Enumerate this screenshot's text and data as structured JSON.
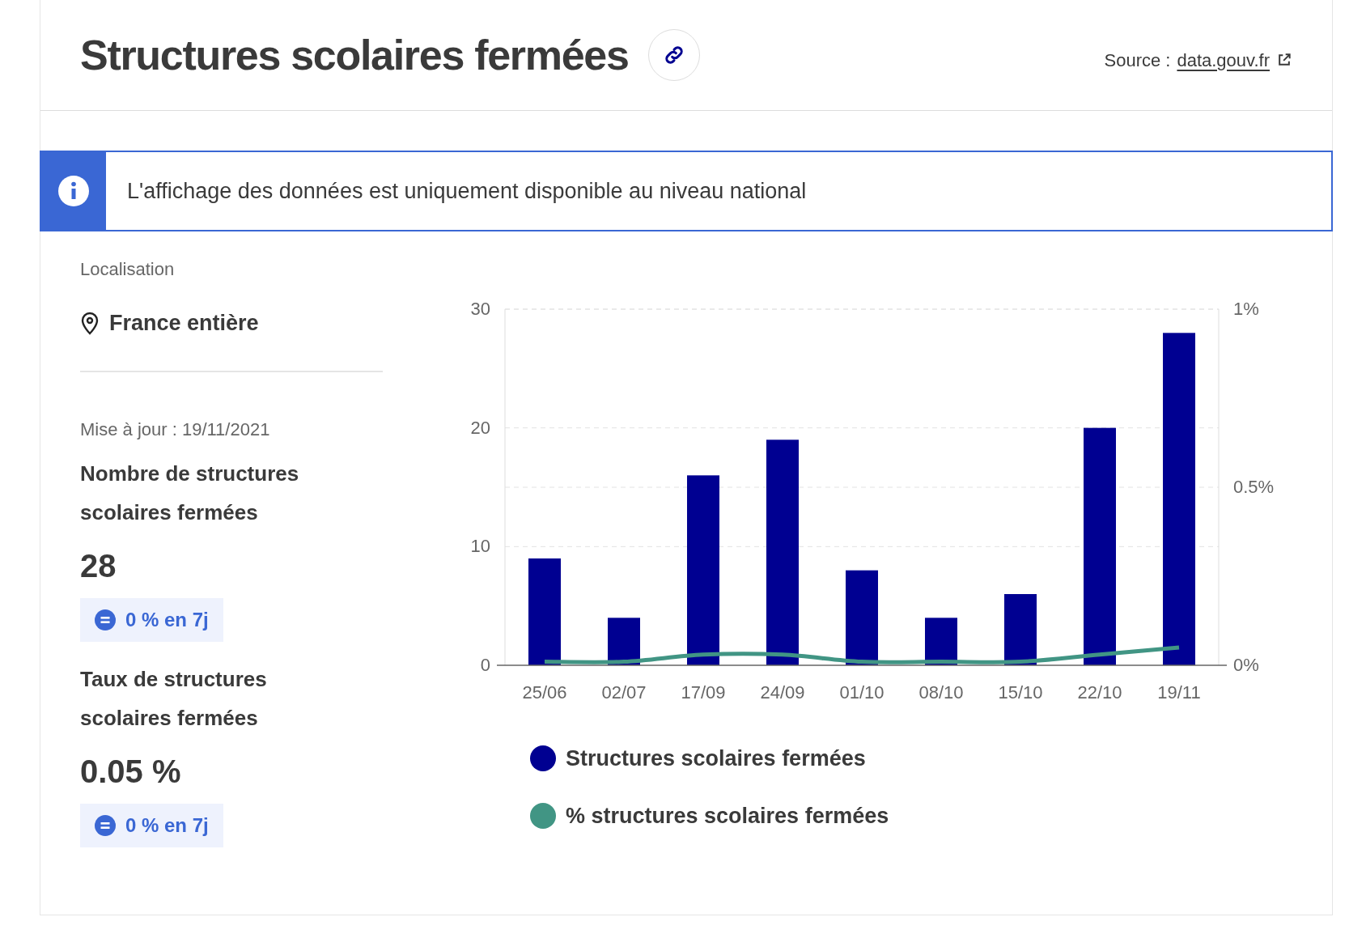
{
  "header": {
    "title": "Structures scolaires fermées",
    "source_label": "Source :",
    "source_link": "data.gouv.fr"
  },
  "info_banner": {
    "text": "L'affichage des données est uniquement disponible au niveau national"
  },
  "location": {
    "label": "Localisation",
    "value": "France entière"
  },
  "updated": "Mise à jour : 19/11/2021",
  "indicators": [
    {
      "label": "Nombre de structures scolaires fermées",
      "value": "28",
      "trend": "0 % en 7j"
    },
    {
      "label": "Taux de structures scolaires fermées",
      "value": "0.05 %",
      "trend": "0 % en 7j"
    }
  ],
  "chart_data": {
    "type": "bar",
    "categories": [
      "25/06",
      "02/07",
      "17/09",
      "24/09",
      "01/10",
      "08/10",
      "15/10",
      "22/10",
      "19/11"
    ],
    "series": [
      {
        "name": "Structures scolaires fermées",
        "color": "#000091",
        "type": "bar",
        "values": [
          9,
          4,
          16,
          19,
          8,
          4,
          6,
          20,
          28
        ]
      },
      {
        "name": "% structures scolaires fermées",
        "color": "#419584",
        "type": "line",
        "axis": "y2",
        "values": [
          0.01,
          0.01,
          0.03,
          0.03,
          0.01,
          0.01,
          0.01,
          0.03,
          0.05
        ]
      }
    ],
    "grid": true,
    "ylim": [
      0,
      30
    ],
    "yticks": [
      0,
      10,
      20,
      30
    ],
    "y2lim": [
      0,
      1
    ],
    "y2ticks": [
      {
        "value": 0,
        "label": "0%"
      },
      {
        "value": 0.5,
        "label": "0.5%"
      },
      {
        "value": 1,
        "label": "1%"
      }
    ]
  }
}
